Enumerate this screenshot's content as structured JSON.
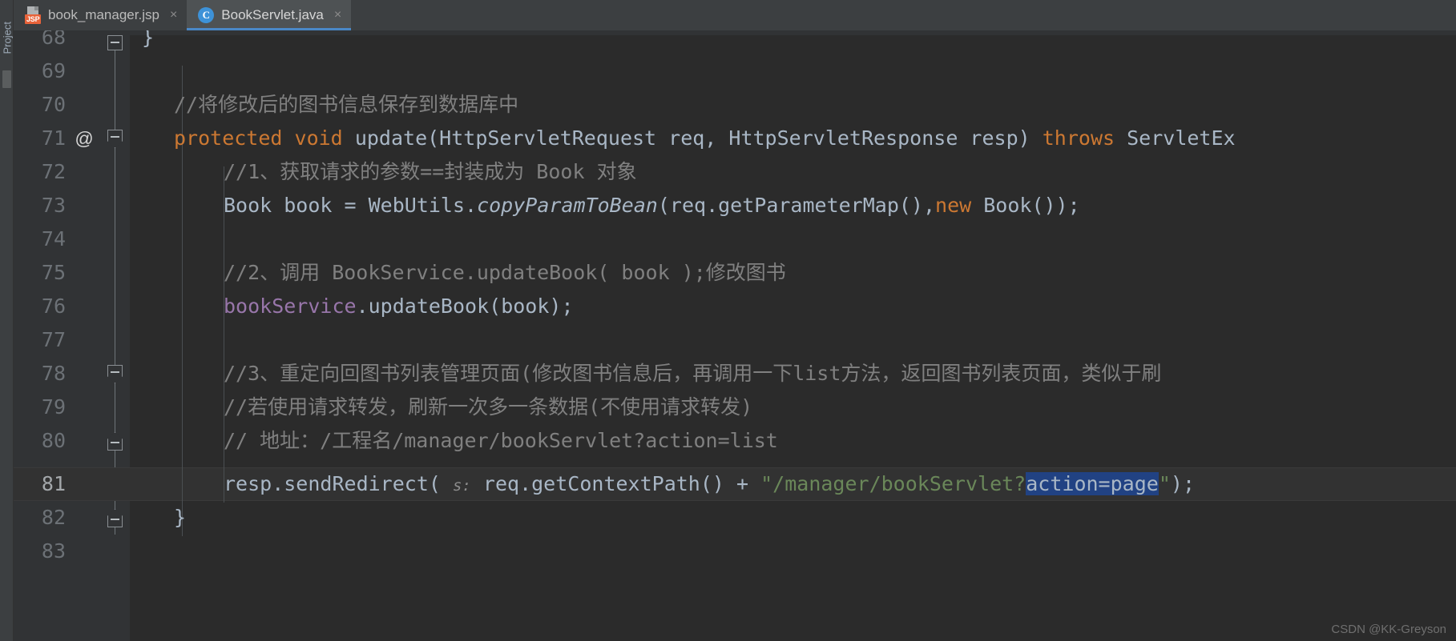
{
  "window": {
    "tool_stripe_label": "Project",
    "watermark": "CSDN @KK-Greyson"
  },
  "tabs": [
    {
      "label": "book_manager.jsp",
      "icon": "jsp-file-icon",
      "badge": "JSP",
      "close": "×",
      "active": false
    },
    {
      "label": "BookServlet.java",
      "icon": "java-class-icon",
      "badge": "C",
      "close": "×",
      "active": true
    }
  ],
  "editor": {
    "current_line": 81,
    "override_marker": "@",
    "lines": [
      {
        "num": "68",
        "text": "}"
      },
      {
        "num": "69",
        "text": ""
      },
      {
        "num": "70",
        "text": "//将修改后的图书信息保存到数据库中"
      },
      {
        "num": "71",
        "text": "protected void update(HttpServletRequest req, HttpServletResponse resp) throws ServletEx"
      },
      {
        "num": "72",
        "text": "//1、获取请求的参数==封装成为 Book 对象"
      },
      {
        "num": "73",
        "text": "Book book = WebUtils.copyParamToBean(req.getParameterMap(),new Book());"
      },
      {
        "num": "74",
        "text": ""
      },
      {
        "num": "75",
        "text": "//2、调用 BookService.updateBook( book );修改图书"
      },
      {
        "num": "76",
        "text": "bookService.updateBook(book);"
      },
      {
        "num": "77",
        "text": ""
      },
      {
        "num": "78",
        "text": "//3、重定向回图书列表管理页面(修改图书信息后，再调用一下list方法，返回图书列表页面，类似于刷"
      },
      {
        "num": "79",
        "text": "//若使用请求转发，刷新一次多一条数据(不使用请求转发)"
      },
      {
        "num": "80",
        "text": "// 地址：/工程名/manager/bookServlet?action=list"
      },
      {
        "num": "81",
        "text": "resp.sendRedirect( s: req.getContextPath() + \"/manager/bookServlet?action=page\");"
      },
      {
        "num": "82",
        "text": "}"
      },
      {
        "num": "83",
        "text": ""
      }
    ],
    "tokens": {
      "l68_brace": "}",
      "l70_comment": "//将修改后的图书信息保存到数据库中",
      "l71_kw1": "protected",
      "l71_kw2": "void",
      "l71_method": "update",
      "l71_params": "(HttpServletRequest req, HttpServletResponse resp) ",
      "l71_kw3": "throws",
      "l71_tail": " ServletEx",
      "l72_comment": "//1、获取请求的参数==封装成为 Book 对象",
      "l73_a": "Book book = WebUtils.",
      "l73_method": "copyParamToBean",
      "l73_b": "(req.getParameterMap(),",
      "l73_kw": "new",
      "l73_c": " Book());",
      "l75_comment": "//2、调用 BookService.updateBook( book );修改图书",
      "l76_field": "bookService",
      "l76_rest": ".updateBook(book);",
      "l78_comment": "//3、重定向回图书列表管理页面(修改图书信息后，再调用一下list方法，返回图书列表页面，类似于刷",
      "l79_comment": "//若使用请求转发，刷新一次多一条数据(不使用请求转发)",
      "l80_comment": "// 地址：/工程名/manager/bookServlet?action=list",
      "l81_a": "resp.sendRedirect( ",
      "l81_hint": "s:",
      "l81_b": " req.getContextPath() + ",
      "l81_str1": "\"/manager/bookServlet?",
      "l81_sel": "action=page",
      "l81_str2": "\"",
      "l81_c": ");",
      "l82_brace": "}"
    }
  },
  "colors": {
    "background": "#2b2b2b",
    "gutter": "#313335",
    "keyword": "#cc7832",
    "comment": "#808080",
    "string": "#6a8759",
    "method": "#ffc66d",
    "field": "#9876aa",
    "text": "#a9b7c6",
    "selection": "#214283",
    "tab_active": "#4e5254",
    "tab_underline": "#4a88c7"
  }
}
